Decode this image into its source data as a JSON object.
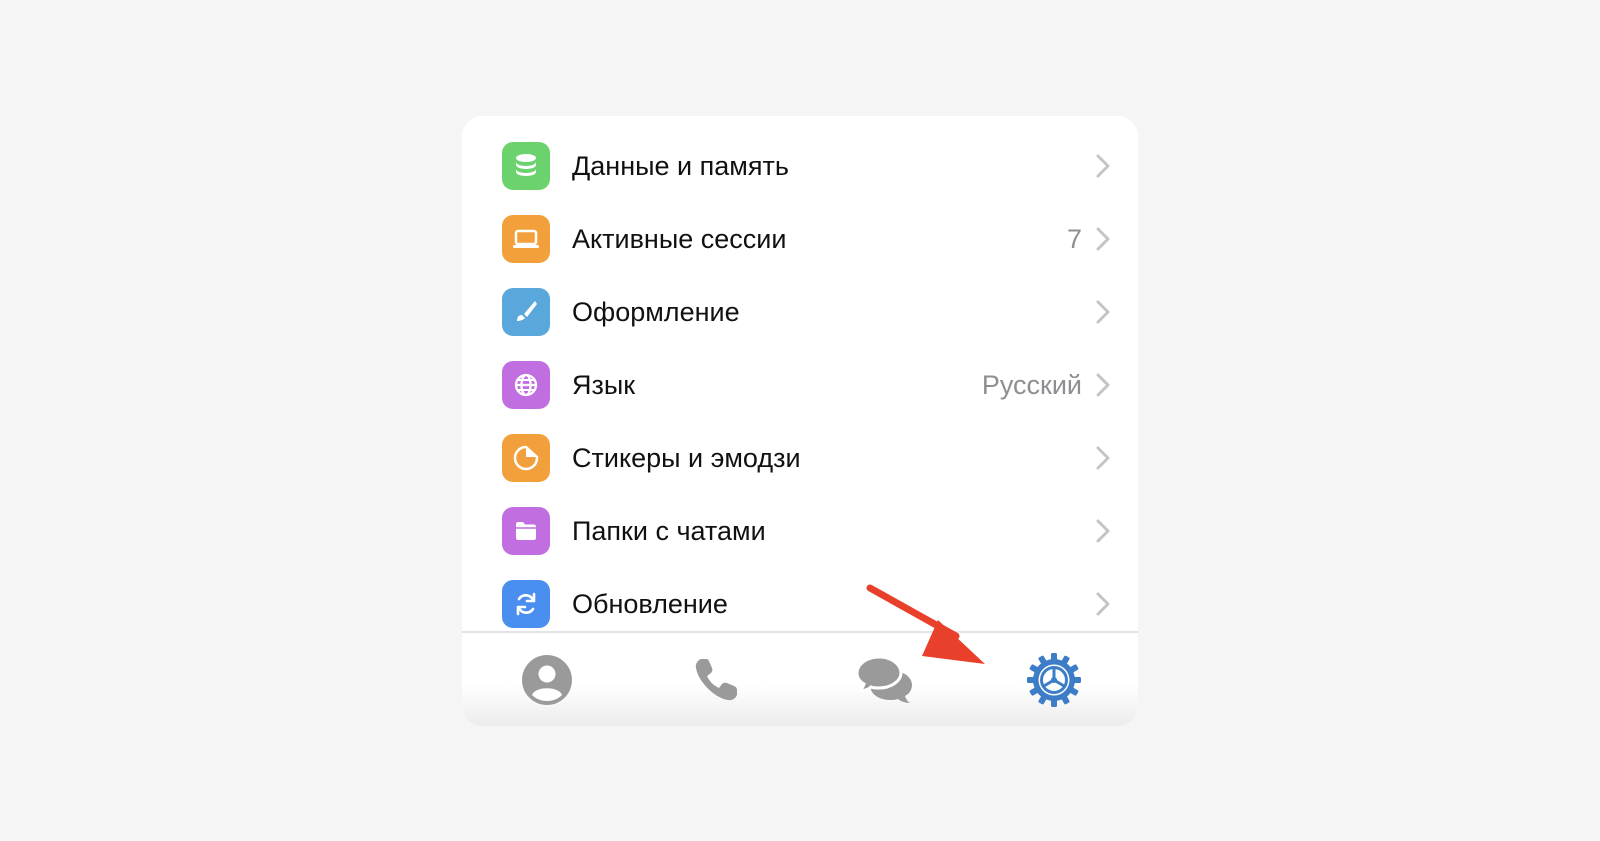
{
  "settings": {
    "items": [
      {
        "label": "Данные и память",
        "value": "",
        "icon": "database-icon",
        "color": "#6cd26e"
      },
      {
        "label": "Активные сессии",
        "value": "7",
        "icon": "laptop-icon",
        "color": "#f2a03c"
      },
      {
        "label": "Оформление",
        "value": "",
        "icon": "brush-icon",
        "color": "#5aa7dc"
      },
      {
        "label": "Язык",
        "value": "Русский",
        "icon": "globe-icon",
        "color": "#c16fe0"
      },
      {
        "label": "Стикеры и эмодзи",
        "value": "",
        "icon": "sticker-icon",
        "color": "#f2a03c"
      },
      {
        "label": "Папки с чатами",
        "value": "",
        "icon": "folder-icon",
        "color": "#c16fe0"
      },
      {
        "label": "Обновление",
        "value": "",
        "icon": "refresh-icon",
        "color": "#4a8ff0"
      }
    ]
  },
  "tabbar": {
    "tabs": [
      {
        "name": "contacts",
        "icon": "person-icon",
        "active": false
      },
      {
        "name": "calls",
        "icon": "phone-icon",
        "active": false
      },
      {
        "name": "chats",
        "icon": "chat-bubbles-icon",
        "active": false
      },
      {
        "name": "settings",
        "icon": "gear-icon",
        "active": true
      }
    ],
    "active_color": "#3d7dc7",
    "inactive_color": "#9a9a9a"
  },
  "annotation": {
    "arrow_color": "#e8402a",
    "points_to": "settings-tab"
  }
}
